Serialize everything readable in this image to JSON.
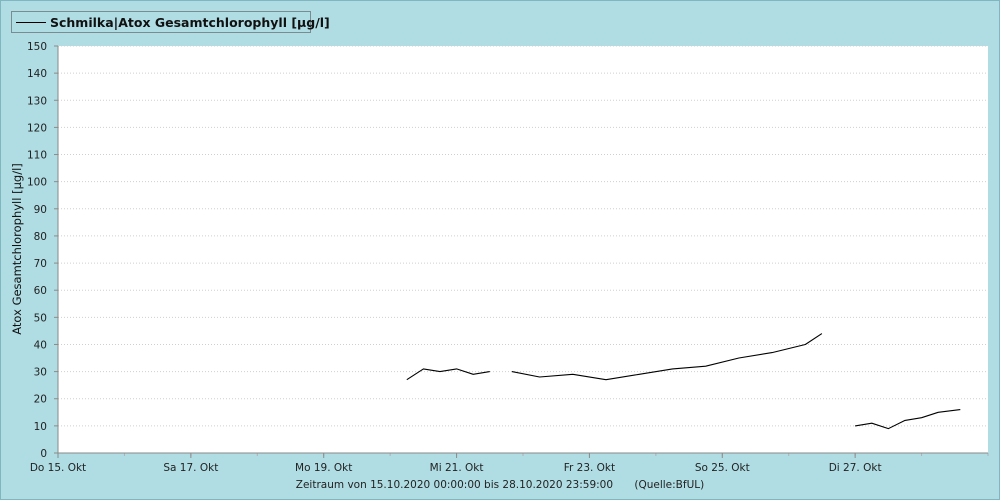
{
  "legend": {
    "label": "Schmilka|Atox Gesamtchlorophyll [µg/l]"
  },
  "footer": {
    "range": "Zeitraum von 15.10.2020 00:00:00 bis 28.10.2020 23:59:00",
    "source": "(Quelle:BfUL)"
  },
  "colors": {
    "background": "#b0dde4",
    "plot": "#ffffff",
    "line": "#000000",
    "grid": "#c8c8c8"
  },
  "chart_data": {
    "type": "line",
    "title": "",
    "xlabel": "",
    "ylabel": "Atox Gesamtchlorophyll [µg/l]",
    "ylim": [
      0,
      150
    ],
    "xlim": [
      "2020-10-15",
      "2020-10-29"
    ],
    "y_ticks": [
      0,
      10,
      20,
      30,
      40,
      50,
      60,
      70,
      80,
      90,
      100,
      110,
      120,
      130,
      140,
      150
    ],
    "x_ticks": [
      {
        "date": "2020-10-15",
        "label": "Do 15. Okt"
      },
      {
        "date": "2020-10-17",
        "label": "Sa 17. Okt"
      },
      {
        "date": "2020-10-19",
        "label": "Mo 19. Okt"
      },
      {
        "date": "2020-10-21",
        "label": "Mi 21. Okt"
      },
      {
        "date": "2020-10-23",
        "label": "Fr 23. Okt"
      },
      {
        "date": "2020-10-25",
        "label": "So 25. Okt"
      },
      {
        "date": "2020-10-27",
        "label": "Di 27. Okt"
      }
    ],
    "grid": true,
    "series": [
      {
        "name": "Schmilka|Atox Gesamtchlorophyll [µg/l]",
        "segments": [
          {
            "x": [
              "2020-10-20 06:00",
              "2020-10-20 12:00",
              "2020-10-20 18:00",
              "2020-10-21 00:00",
              "2020-10-21 06:00",
              "2020-10-21 12:00"
            ],
            "y": [
              27,
              31,
              30,
              31,
              29,
              30
            ]
          },
          {
            "x": [
              "2020-10-21 20:00",
              "2020-10-22 06:00",
              "2020-10-22 18:00",
              "2020-10-23 06:00",
              "2020-10-23 18:00",
              "2020-10-24 06:00",
              "2020-10-24 18:00",
              "2020-10-25 06:00",
              "2020-10-25 18:00",
              "2020-10-26 06:00",
              "2020-10-26 12:00"
            ],
            "y": [
              30,
              28,
              29,
              27,
              29,
              31,
              32,
              35,
              37,
              40,
              44
            ]
          },
          {
            "x": [
              "2020-10-27 00:00",
              "2020-10-27 06:00",
              "2020-10-27 12:00",
              "2020-10-27 18:00",
              "2020-10-28 00:00",
              "2020-10-28 06:00",
              "2020-10-28 14:00"
            ],
            "y": [
              10,
              11,
              9,
              12,
              13,
              15,
              16
            ]
          }
        ]
      }
    ]
  }
}
